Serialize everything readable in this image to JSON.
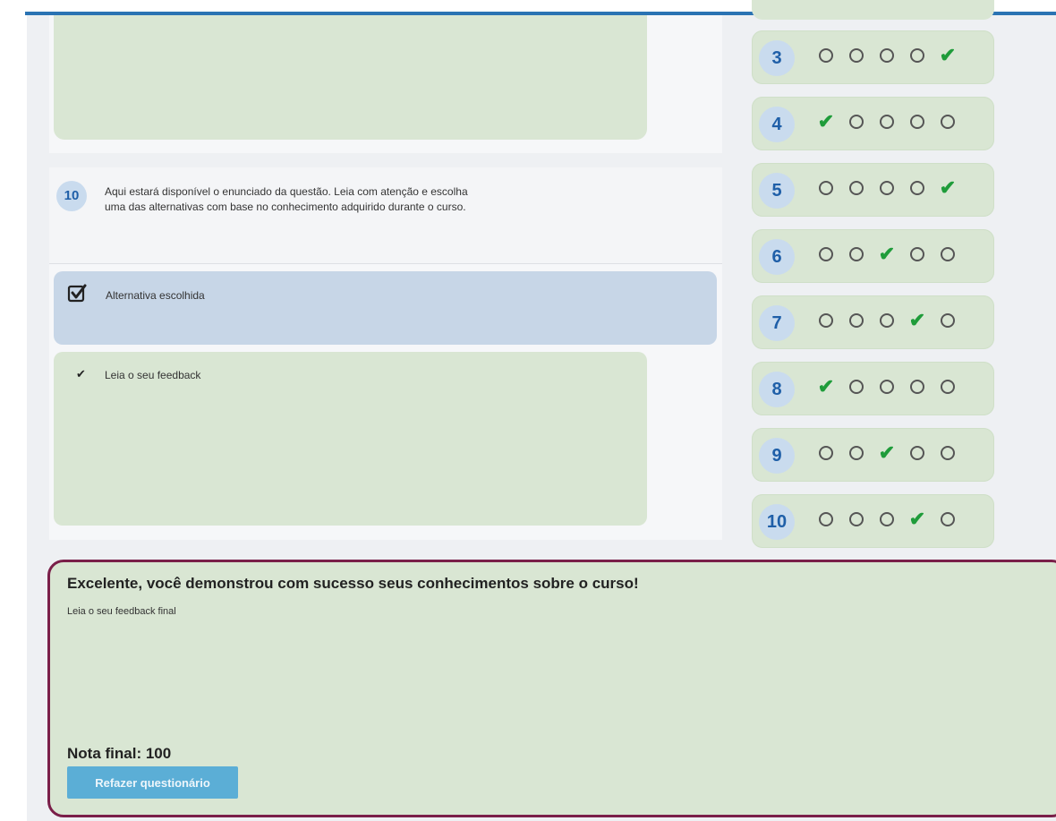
{
  "question": {
    "number": "10",
    "text_line1": "Aqui estará disponível o enunciado da questão. Leia com atenção e escolha",
    "text_line2": "uma das alternativas com base no conhecimento adquirido durante o curso.",
    "chosen_alternative_label": "Alternativa escolhida",
    "feedback_label": "Leia o seu feedback"
  },
  "score_rows": [
    {
      "number": "3",
      "answers": [
        "circle",
        "circle",
        "circle",
        "circle",
        "check"
      ]
    },
    {
      "number": "4",
      "answers": [
        "check",
        "circle",
        "circle",
        "circle",
        "circle"
      ]
    },
    {
      "number": "5",
      "answers": [
        "circle",
        "circle",
        "circle",
        "circle",
        "check"
      ]
    },
    {
      "number": "6",
      "answers": [
        "circle",
        "circle",
        "check",
        "circle",
        "circle"
      ]
    },
    {
      "number": "7",
      "answers": [
        "circle",
        "circle",
        "circle",
        "check",
        "circle"
      ]
    },
    {
      "number": "8",
      "answers": [
        "check",
        "circle",
        "circle",
        "circle",
        "circle"
      ]
    },
    {
      "number": "9",
      "answers": [
        "circle",
        "circle",
        "check",
        "circle",
        "circle"
      ]
    },
    {
      "number": "10",
      "answers": [
        "circle",
        "circle",
        "circle",
        "check",
        "circle"
      ]
    }
  ],
  "final": {
    "title": "Excelente, você demonstrou com sucesso seus conhecimentos sobre o curso!",
    "subtitle": "Leia o seu feedback final",
    "grade": "Nota final: 100",
    "redo_button": "Refazer questionário"
  },
  "colors": {
    "accent_blue": "#2a73b3",
    "correct_green": "#1f9c3a",
    "final_border": "#7a1f49",
    "button": "#5baed6"
  }
}
